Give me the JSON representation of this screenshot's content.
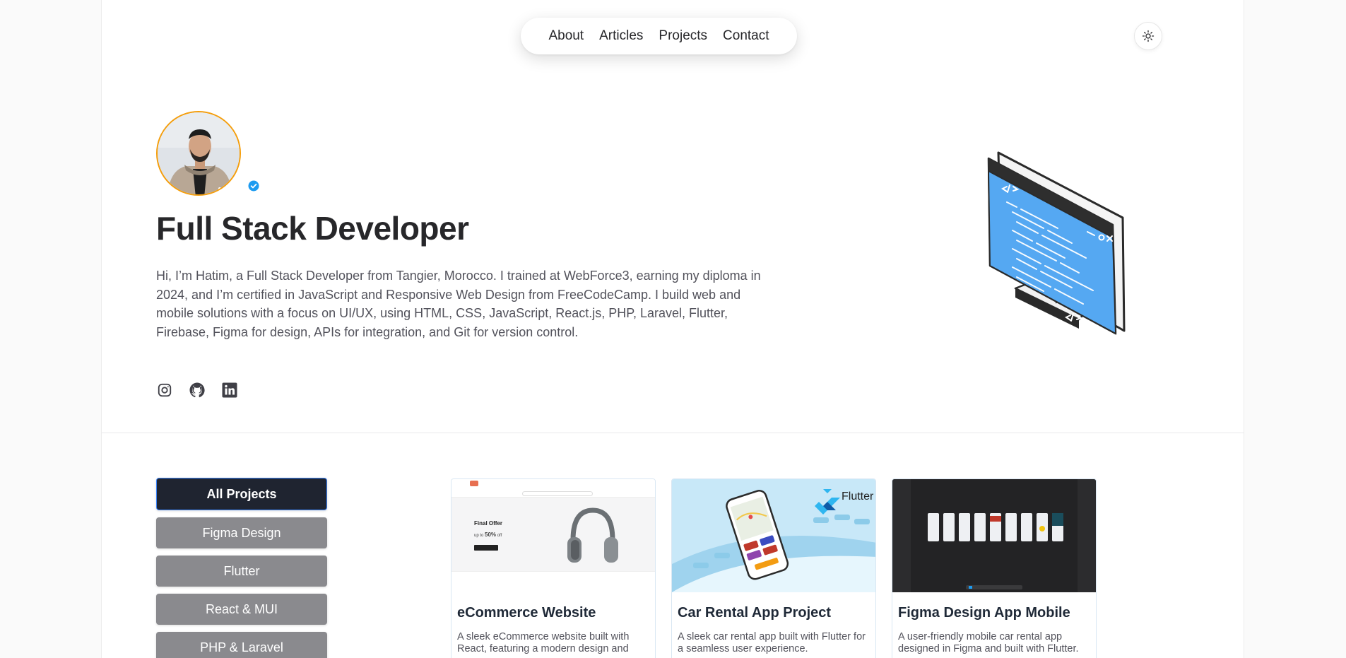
{
  "nav": {
    "items": [
      "About",
      "Articles",
      "Projects",
      "Contact"
    ]
  },
  "theme_toggle": {
    "icon": "sun-icon"
  },
  "hero": {
    "title": "Full Stack Developer",
    "bio": "Hi, I’m Hatim, a Full Stack Developer from Tangier, Morocco. I trained at WebForce3, earning my diploma in 2024, and I’m certified in JavaScript and Responsive Web Design from FreeCodeCamp. I build web and mobile solutions with a focus on UI/UX, using HTML, CSS, JavaScript, React.js, PHP, Laravel, Flutter, Firebase, Figma for design, APIs for integration, and Git for version control.",
    "socials": [
      "instagram-icon",
      "github-icon",
      "linkedin-icon"
    ],
    "accent": "#f59e0b"
  },
  "filters": [
    "All Projects",
    "Figma Design",
    "Flutter",
    "React & MUI",
    "PHP & Laravel"
  ],
  "projects": [
    {
      "title": "eCommerce Website",
      "description": "A sleek eCommerce website built with React, featuring a modern design and",
      "thumb": {
        "headline": "Final Offer",
        "discount": "50%"
      }
    },
    {
      "title": "Car Rental App Project",
      "description": "A sleek car rental app built with Flutter for a seamless user experience.",
      "thumb": {
        "brand": "Flutter"
      }
    },
    {
      "title": "Figma Design App Mobile",
      "description": "A user-friendly mobile car rental app designed in Figma and built with Flutter."
    }
  ]
}
